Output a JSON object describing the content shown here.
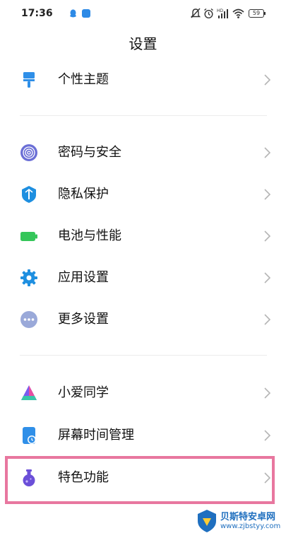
{
  "status_bar": {
    "time": "17:36",
    "battery": "59",
    "icons": [
      "qq-icon",
      "app-badge-icon",
      "notification-off-icon",
      "alarm-icon",
      "cellular-signal-icon",
      "wifi-icon",
      "battery-icon"
    ]
  },
  "header": {
    "title": "设置"
  },
  "groups": [
    {
      "items": [
        {
          "label": "个性主题",
          "icon": "paint-brush-icon",
          "color": "#2f8fe8"
        }
      ]
    },
    {
      "items": [
        {
          "label": "密码与安全",
          "icon": "fingerprint-icon",
          "color": "#6b6fd6"
        },
        {
          "label": "隐私保护",
          "icon": "privacy-shield-icon",
          "color": "#1e8fe0"
        },
        {
          "label": "电池与性能",
          "icon": "battery-icon",
          "color": "#35c65a"
        },
        {
          "label": "应用设置",
          "icon": "gear-icon",
          "color": "#1e8fe0"
        },
        {
          "label": "更多设置",
          "icon": "more-dots-icon",
          "color": "#9aa9d9"
        }
      ]
    },
    {
      "items": [
        {
          "label": "小爱同学",
          "icon": "xiaoai-icon",
          "color": "#7a5cf0"
        },
        {
          "label": "屏幕时间管理",
          "icon": "screen-time-icon",
          "color": "#2f8fe8"
        },
        {
          "label": "特色功能",
          "icon": "flask-icon",
          "color": "#6b4fd8"
        }
      ]
    }
  ],
  "highlight_color": "#e8779f",
  "watermark": {
    "name": "贝斯特安卓网",
    "url": "www.zjbstyy.com"
  }
}
